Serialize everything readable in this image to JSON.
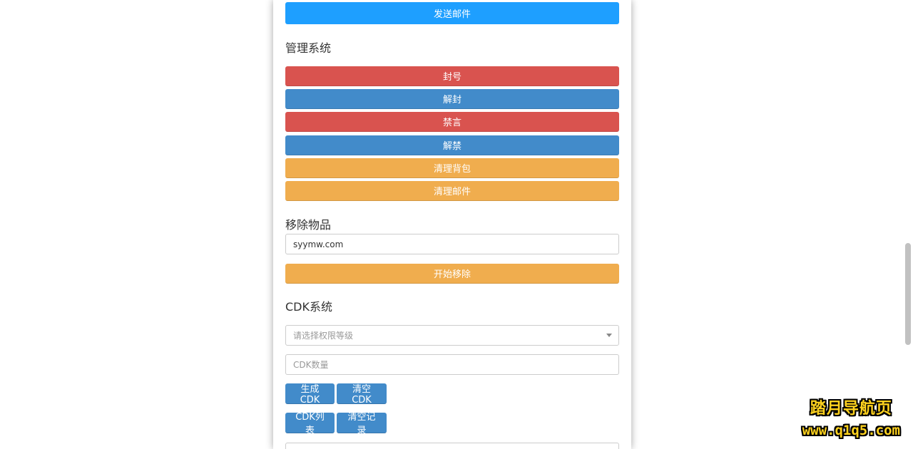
{
  "mail": {
    "send_label": "发送邮件"
  },
  "admin": {
    "title": "管理系统",
    "buttons": [
      {
        "label": "封号",
        "style": "danger"
      },
      {
        "label": "解封",
        "style": "info"
      },
      {
        "label": "禁言",
        "style": "danger"
      },
      {
        "label": "解禁",
        "style": "info"
      },
      {
        "label": "清理背包",
        "style": "warning"
      },
      {
        "label": "清理邮件",
        "style": "warning"
      }
    ]
  },
  "remove_item": {
    "title": "移除物品",
    "input_value": "syymw.com",
    "start_label": "开始移除"
  },
  "cdk": {
    "title": "CDK系统",
    "level_select_placeholder": "请选择权限等级",
    "count_placeholder": "CDK数量",
    "generate_label": "生成CDK",
    "clear_label": "清空CDK",
    "list_label": "CDK列表",
    "clear_records_label": "清空记录"
  },
  "watermark": {
    "title": "踏月导航页",
    "url": "www.q1q5.com"
  },
  "colors": {
    "primary": "#1e9fff",
    "danger": "#d9534f",
    "info": "#428bca",
    "warning": "#f0ad4e"
  }
}
